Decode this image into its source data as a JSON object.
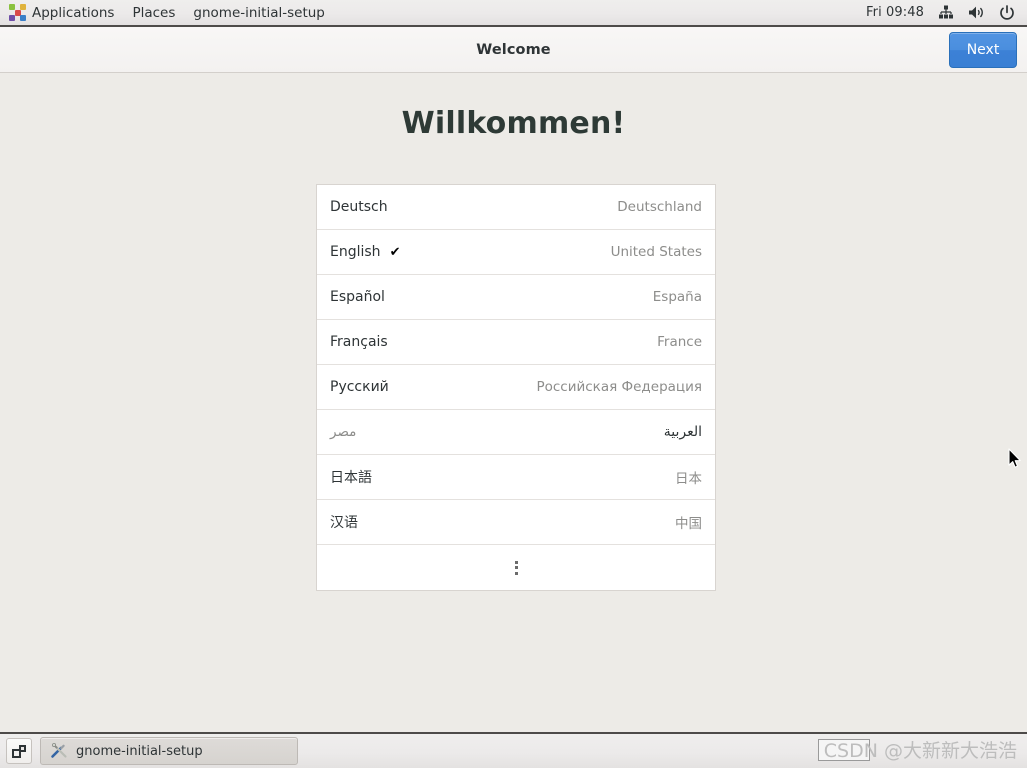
{
  "top_panel": {
    "applications_label": "Applications",
    "places_label": "Places",
    "window_title": "gnome-initial-setup",
    "clock": "Fri 09:48",
    "icons": {
      "apps": "gnome-foot-icon",
      "network": "network-wired-icon",
      "volume": "volume-high-icon",
      "power": "power-icon"
    }
  },
  "headerbar": {
    "title": "Welcome",
    "next_label": "Next"
  },
  "main": {
    "welcome_title": "Willkommen!",
    "languages": [
      {
        "name": "Deutsch",
        "country": "Deutschland",
        "selected": false,
        "rtl": false
      },
      {
        "name": "English",
        "country": "United States",
        "selected": true,
        "rtl": false
      },
      {
        "name": "Español",
        "country": "España",
        "selected": false,
        "rtl": false
      },
      {
        "name": "Français",
        "country": "France",
        "selected": false,
        "rtl": false
      },
      {
        "name": "Русский",
        "country": "Российская Федерация",
        "selected": false,
        "rtl": false
      },
      {
        "name": "العربية",
        "country": "مصر",
        "selected": false,
        "rtl": true
      },
      {
        "name": "日本語",
        "country": "日本",
        "selected": false,
        "rtl": false
      },
      {
        "name": "汉语",
        "country": "中国",
        "selected": false,
        "rtl": false
      }
    ],
    "check_glyph": "✔",
    "more_icon": "more-vertical-icon"
  },
  "taskbar": {
    "show_desktop_icon": "show-desktop-icon",
    "task_icon": "tools-icon",
    "task_label": "gnome-initial-setup"
  },
  "watermark": {
    "text": "CSDN @大新新大浩浩"
  },
  "colors": {
    "accent": "#4a8ede",
    "page_bg": "#edebe7",
    "headerbar_bg": "#f6f5f4",
    "panel_bg": "#eceaea",
    "list_bg": "#ffffff",
    "text": "#2e3436",
    "muted_text": "#8d8d8b"
  }
}
